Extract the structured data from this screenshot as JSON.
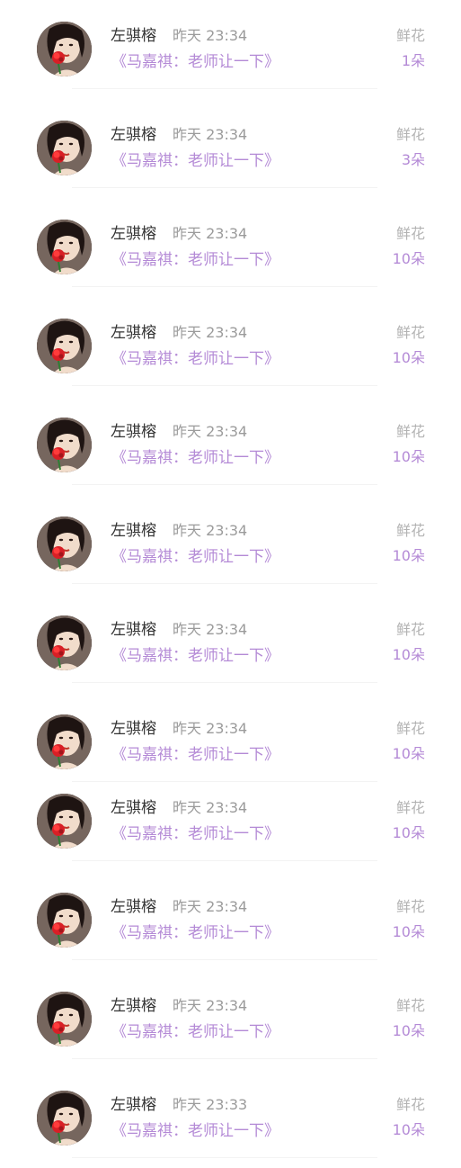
{
  "items": [
    {
      "name": "左骐榕",
      "time": "昨天 23:34",
      "title": "《马嘉祺：老师让一下》",
      "gift": "鲜花",
      "count": "1朵"
    },
    {
      "name": "左骐榕",
      "time": "昨天 23:34",
      "title": "《马嘉祺：老师让一下》",
      "gift": "鲜花",
      "count": "3朵"
    },
    {
      "name": "左骐榕",
      "time": "昨天 23:34",
      "title": "《马嘉祺：老师让一下》",
      "gift": "鲜花",
      "count": "10朵"
    },
    {
      "name": "左骐榕",
      "time": "昨天 23:34",
      "title": "《马嘉祺：老师让一下》",
      "gift": "鲜花",
      "count": "10朵"
    },
    {
      "name": "左骐榕",
      "time": "昨天 23:34",
      "title": "《马嘉祺：老师让一下》",
      "gift": "鲜花",
      "count": "10朵"
    },
    {
      "name": "左骐榕",
      "time": "昨天 23:34",
      "title": "《马嘉祺：老师让一下》",
      "gift": "鲜花",
      "count": "10朵"
    },
    {
      "name": "左骐榕",
      "time": "昨天 23:34",
      "title": "《马嘉祺：老师让一下》",
      "gift": "鲜花",
      "count": "10朵"
    },
    {
      "name": "左骐榕",
      "time": "昨天 23:34",
      "title": "《马嘉祺：老师让一下》",
      "gift": "鲜花",
      "count": "10朵"
    },
    {
      "name": "左骐榕",
      "time": "昨天 23:34",
      "title": "《马嘉祺：老师让一下》",
      "gift": "鲜花",
      "count": "10朵"
    },
    {
      "name": "左骐榕",
      "time": "昨天 23:34",
      "title": "《马嘉祺：老师让一下》",
      "gift": "鲜花",
      "count": "10朵"
    },
    {
      "name": "左骐榕",
      "time": "昨天 23:34",
      "title": "《马嘉祺：老师让一下》",
      "gift": "鲜花",
      "count": "10朵"
    },
    {
      "name": "左骐榕",
      "time": "昨天 23:33",
      "title": "《马嘉祺：老师让一下》",
      "gift": "鲜花",
      "count": "10朵"
    }
  ],
  "colors": {
    "accent": "#b48ad6",
    "name": "#333333",
    "time": "#9b9b9b",
    "gift_label": "#b3b3b3"
  },
  "icons": {
    "avatar": "user-avatar-with-red-rose"
  }
}
